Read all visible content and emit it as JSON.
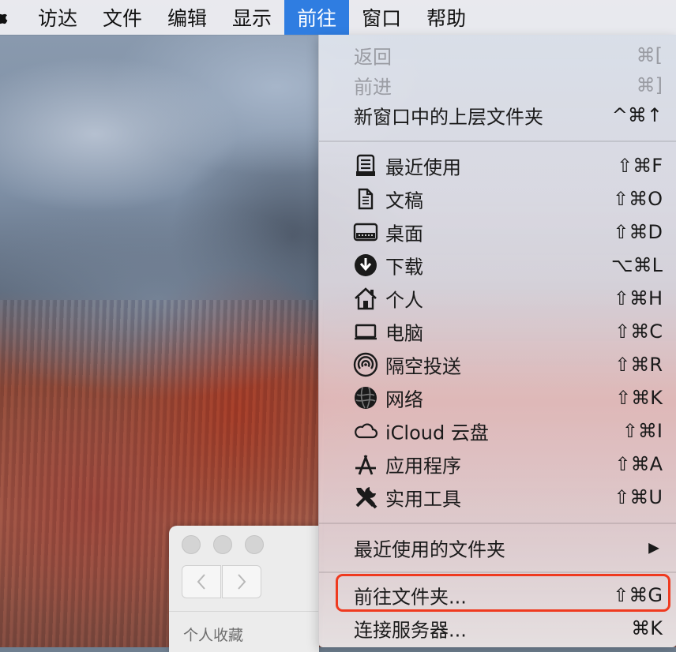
{
  "menubar": {
    "apple_icon": "apple-icon",
    "items": [
      {
        "label": "访达"
      },
      {
        "label": "文件"
      },
      {
        "label": "编辑"
      },
      {
        "label": "显示"
      },
      {
        "label": "前往",
        "active": true
      },
      {
        "label": "窗口"
      },
      {
        "label": "帮助"
      }
    ]
  },
  "go_menu": {
    "nav": [
      {
        "label": "返回",
        "shortcut": "⌘[",
        "enabled": false
      },
      {
        "label": "前进",
        "shortcut": "⌘]",
        "enabled": false
      },
      {
        "label": "新窗口中的上层文件夹",
        "shortcut": "^⌘↑",
        "enabled": true
      }
    ],
    "locations": [
      {
        "label": "最近使用",
        "shortcut": "⇧⌘F",
        "icon": "recents-icon"
      },
      {
        "label": "文稿",
        "shortcut": "⇧⌘O",
        "icon": "documents-icon"
      },
      {
        "label": "桌面",
        "shortcut": "⇧⌘D",
        "icon": "desktop-icon"
      },
      {
        "label": "下载",
        "shortcut": "⌥⌘L",
        "icon": "downloads-icon"
      },
      {
        "label": "个人",
        "shortcut": "⇧⌘H",
        "icon": "home-icon"
      },
      {
        "label": "电脑",
        "shortcut": "⇧⌘C",
        "icon": "computer-icon"
      },
      {
        "label": "隔空投送",
        "shortcut": "⇧⌘R",
        "icon": "airdrop-icon"
      },
      {
        "label": "网络",
        "shortcut": "⇧⌘K",
        "icon": "network-icon"
      },
      {
        "label": "iCloud 云盘",
        "shortcut": "⇧⌘I",
        "icon": "icloud-icon"
      },
      {
        "label": "应用程序",
        "shortcut": "⇧⌘A",
        "icon": "applications-icon"
      },
      {
        "label": "实用工具",
        "shortcut": "⇧⌘U",
        "icon": "utilities-icon"
      }
    ],
    "recent_folders": {
      "label": "最近使用的文件夹",
      "submenu_indicator": "▶"
    },
    "goto_folder": {
      "label": "前往文件夹...",
      "shortcut": "⇧⌘G",
      "highlight_color": "#ef3a1f"
    },
    "connect_server": {
      "label": "连接服务器...",
      "shortcut": "⌘K"
    }
  },
  "finder_window": {
    "sidebar_heading": "个人收藏"
  },
  "colors": {
    "menu_active": "#2f7de1",
    "highlight_box": "#ef3a1f"
  }
}
